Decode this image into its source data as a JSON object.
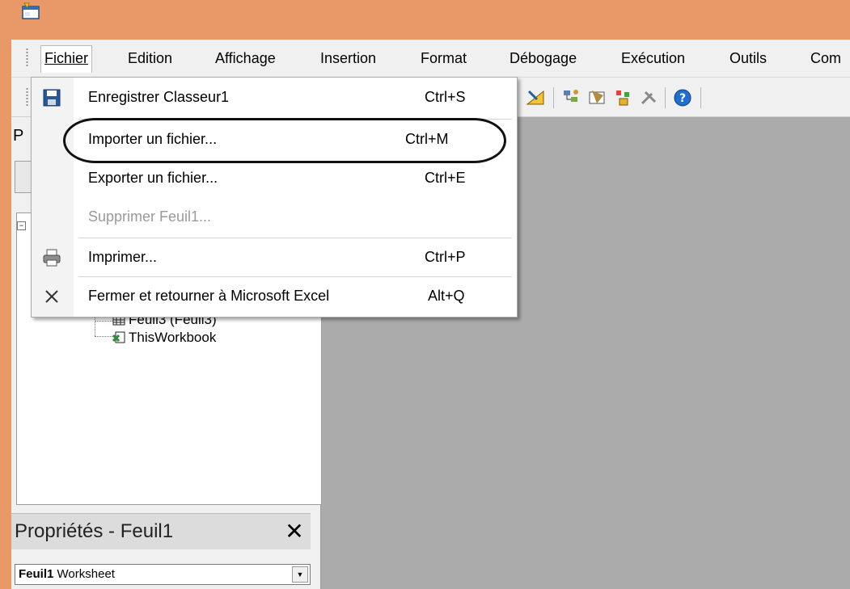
{
  "colors": {
    "titlebar": "#e99868",
    "mdi_background": "#ababab",
    "menu_bg": "#f0f0f0"
  },
  "menubar": {
    "items": [
      {
        "label": "Fichier",
        "open": true
      },
      {
        "label": "Edition"
      },
      {
        "label": "Affichage"
      },
      {
        "label": "Insertion"
      },
      {
        "label": "Format"
      },
      {
        "label": "Débogage"
      },
      {
        "label": "Exécution"
      },
      {
        "label": "Outils"
      },
      {
        "label": "Com"
      }
    ]
  },
  "file_menu": {
    "items": [
      {
        "label": "Enregistrer Classeur1",
        "shortcut": "Ctrl+S",
        "icon": "save-icon"
      },
      {
        "label": "Importer un fichier...",
        "shortcut": "Ctrl+M"
      },
      {
        "label": "Exporter un fichier...",
        "shortcut": "Ctrl+E"
      },
      {
        "label": "Supprimer Feuil1...",
        "shortcut": "",
        "disabled": true
      },
      {
        "label": "Imprimer...",
        "shortcut": "Ctrl+P",
        "icon": "printer-icon"
      },
      {
        "label": "Fermer et retourner à Microsoft Excel",
        "shortcut": "Alt+Q",
        "icon": "close-x-icon"
      }
    ]
  },
  "project": {
    "title_partial": "P",
    "tree": [
      {
        "label": "Feuil3 (Feuil3)",
        "icon": "worksheet-icon"
      },
      {
        "label": "ThisWorkbook",
        "icon": "workbook-icon"
      }
    ]
  },
  "properties": {
    "title": "Propriétés - Feuil1",
    "close_glyph": "✕",
    "object_name": "Feuil1",
    "object_type": "Worksheet"
  }
}
